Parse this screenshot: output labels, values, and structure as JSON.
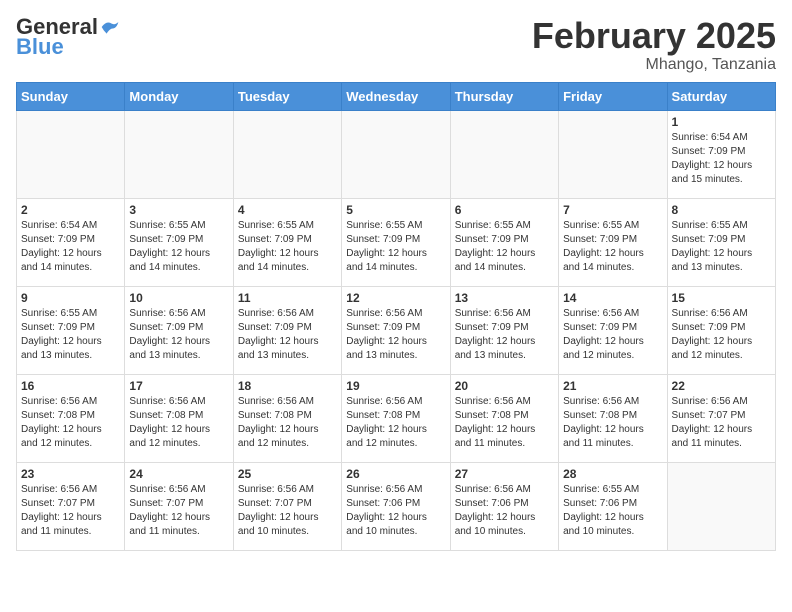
{
  "header": {
    "logo_general": "General",
    "logo_blue": "Blue",
    "month_title": "February 2025",
    "location": "Mhango, Tanzania"
  },
  "weekdays": [
    "Sunday",
    "Monday",
    "Tuesday",
    "Wednesday",
    "Thursday",
    "Friday",
    "Saturday"
  ],
  "weeks": [
    [
      {
        "day": "",
        "info": ""
      },
      {
        "day": "",
        "info": ""
      },
      {
        "day": "",
        "info": ""
      },
      {
        "day": "",
        "info": ""
      },
      {
        "day": "",
        "info": ""
      },
      {
        "day": "",
        "info": ""
      },
      {
        "day": "1",
        "info": "Sunrise: 6:54 AM\nSunset: 7:09 PM\nDaylight: 12 hours\nand 15 minutes."
      }
    ],
    [
      {
        "day": "2",
        "info": "Sunrise: 6:54 AM\nSunset: 7:09 PM\nDaylight: 12 hours\nand 14 minutes."
      },
      {
        "day": "3",
        "info": "Sunrise: 6:55 AM\nSunset: 7:09 PM\nDaylight: 12 hours\nand 14 minutes."
      },
      {
        "day": "4",
        "info": "Sunrise: 6:55 AM\nSunset: 7:09 PM\nDaylight: 12 hours\nand 14 minutes."
      },
      {
        "day": "5",
        "info": "Sunrise: 6:55 AM\nSunset: 7:09 PM\nDaylight: 12 hours\nand 14 minutes."
      },
      {
        "day": "6",
        "info": "Sunrise: 6:55 AM\nSunset: 7:09 PM\nDaylight: 12 hours\nand 14 minutes."
      },
      {
        "day": "7",
        "info": "Sunrise: 6:55 AM\nSunset: 7:09 PM\nDaylight: 12 hours\nand 14 minutes."
      },
      {
        "day": "8",
        "info": "Sunrise: 6:55 AM\nSunset: 7:09 PM\nDaylight: 12 hours\nand 13 minutes."
      }
    ],
    [
      {
        "day": "9",
        "info": "Sunrise: 6:55 AM\nSunset: 7:09 PM\nDaylight: 12 hours\nand 13 minutes."
      },
      {
        "day": "10",
        "info": "Sunrise: 6:56 AM\nSunset: 7:09 PM\nDaylight: 12 hours\nand 13 minutes."
      },
      {
        "day": "11",
        "info": "Sunrise: 6:56 AM\nSunset: 7:09 PM\nDaylight: 12 hours\nand 13 minutes."
      },
      {
        "day": "12",
        "info": "Sunrise: 6:56 AM\nSunset: 7:09 PM\nDaylight: 12 hours\nand 13 minutes."
      },
      {
        "day": "13",
        "info": "Sunrise: 6:56 AM\nSunset: 7:09 PM\nDaylight: 12 hours\nand 13 minutes."
      },
      {
        "day": "14",
        "info": "Sunrise: 6:56 AM\nSunset: 7:09 PM\nDaylight: 12 hours\nand 12 minutes."
      },
      {
        "day": "15",
        "info": "Sunrise: 6:56 AM\nSunset: 7:09 PM\nDaylight: 12 hours\nand 12 minutes."
      }
    ],
    [
      {
        "day": "16",
        "info": "Sunrise: 6:56 AM\nSunset: 7:08 PM\nDaylight: 12 hours\nand 12 minutes."
      },
      {
        "day": "17",
        "info": "Sunrise: 6:56 AM\nSunset: 7:08 PM\nDaylight: 12 hours\nand 12 minutes."
      },
      {
        "day": "18",
        "info": "Sunrise: 6:56 AM\nSunset: 7:08 PM\nDaylight: 12 hours\nand 12 minutes."
      },
      {
        "day": "19",
        "info": "Sunrise: 6:56 AM\nSunset: 7:08 PM\nDaylight: 12 hours\nand 12 minutes."
      },
      {
        "day": "20",
        "info": "Sunrise: 6:56 AM\nSunset: 7:08 PM\nDaylight: 12 hours\nand 11 minutes."
      },
      {
        "day": "21",
        "info": "Sunrise: 6:56 AM\nSunset: 7:08 PM\nDaylight: 12 hours\nand 11 minutes."
      },
      {
        "day": "22",
        "info": "Sunrise: 6:56 AM\nSunset: 7:07 PM\nDaylight: 12 hours\nand 11 minutes."
      }
    ],
    [
      {
        "day": "23",
        "info": "Sunrise: 6:56 AM\nSunset: 7:07 PM\nDaylight: 12 hours\nand 11 minutes."
      },
      {
        "day": "24",
        "info": "Sunrise: 6:56 AM\nSunset: 7:07 PM\nDaylight: 12 hours\nand 11 minutes."
      },
      {
        "day": "25",
        "info": "Sunrise: 6:56 AM\nSunset: 7:07 PM\nDaylight: 12 hours\nand 10 minutes."
      },
      {
        "day": "26",
        "info": "Sunrise: 6:56 AM\nSunset: 7:06 PM\nDaylight: 12 hours\nand 10 minutes."
      },
      {
        "day": "27",
        "info": "Sunrise: 6:56 AM\nSunset: 7:06 PM\nDaylight: 12 hours\nand 10 minutes."
      },
      {
        "day": "28",
        "info": "Sunrise: 6:55 AM\nSunset: 7:06 PM\nDaylight: 12 hours\nand 10 minutes."
      },
      {
        "day": "",
        "info": ""
      }
    ]
  ]
}
